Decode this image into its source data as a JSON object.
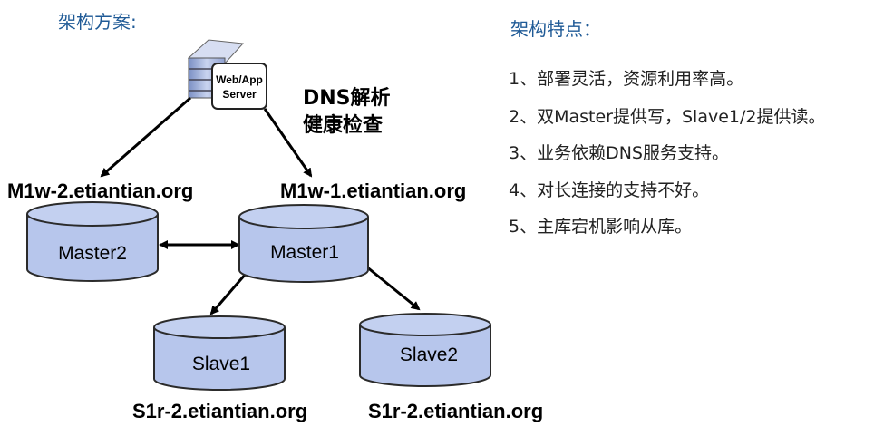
{
  "left_heading": "架构方案:",
  "right_heading": "架构特点：",
  "server": {
    "line1": "Web/App",
    "line2": "Server"
  },
  "dns": {
    "line1": "DNS解析",
    "line2": "健康检查"
  },
  "hosts": {
    "m1w2": "M1w-2.etiantian.org",
    "m1w1": "M1w-1.etiantian.org",
    "s1r2_left": "S1r-2.etiantian.org",
    "s1r2_right": "S1r-2.etiantian.org"
  },
  "databases": {
    "master2": "Master2",
    "master1": "Master1",
    "slave1": "Slave1",
    "slave2": "Slave2"
  },
  "features": [
    "1、部署灵活，资源利用率高。",
    "2、双Master提供写，Slave1/2提供读。",
    "3、业务依赖DNS服务支持。",
    "4、对长连接的支持不好。",
    "5、主库宕机影响从库。"
  ],
  "colors": {
    "heading": "#1f5a96",
    "db_fill": "#b7c6ec",
    "db_stroke": "#2b2b2b"
  }
}
